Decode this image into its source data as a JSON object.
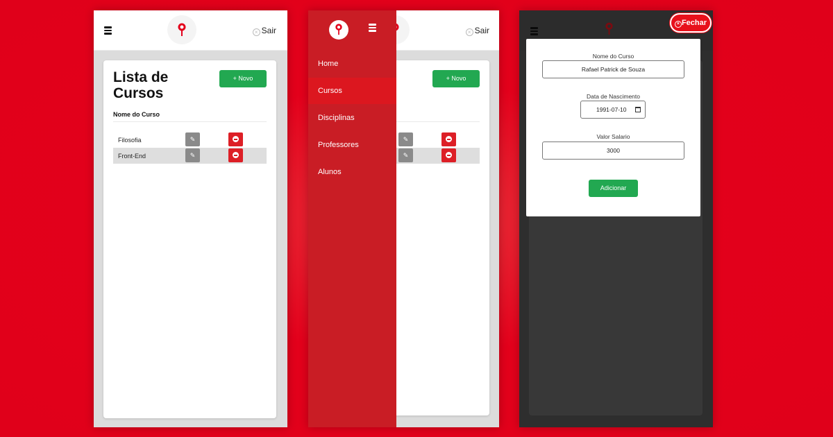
{
  "header": {
    "sair_label": "Sair"
  },
  "list": {
    "title": "Lista de Cursos",
    "novo_label": "+ Novo",
    "column_header": "Nome do Curso",
    "rows": [
      {
        "name": "Filosofia"
      },
      {
        "name": "Front-End"
      }
    ]
  },
  "sidebar": {
    "items": [
      {
        "label": "Home"
      },
      {
        "label": "Cursos",
        "active": true
      },
      {
        "label": "Disciplinas"
      },
      {
        "label": "Professores"
      },
      {
        "label": "Alunos"
      }
    ]
  },
  "modal": {
    "close_label": "Fechar",
    "nome_label": "Nome do Curso",
    "nome_value": "Rafael Patrick de Souza",
    "data_label": "Data de Nascimento",
    "data_value": "1991-07-10",
    "salario_label": "Valor Salario",
    "salario_value": "3000",
    "submit_label": "Adicionar"
  },
  "colors": {
    "brand_red": "#e3001b",
    "sidebar_red": "#c91d25",
    "success_green": "#22a851",
    "delete_red": "#dd1f26",
    "edit_gray": "#8a8a8a"
  },
  "icons": [
    "menu-icon",
    "logo-pin-icon",
    "close-circle-icon",
    "pencil-icon",
    "minus-circle-icon",
    "calendar-icon"
  ]
}
